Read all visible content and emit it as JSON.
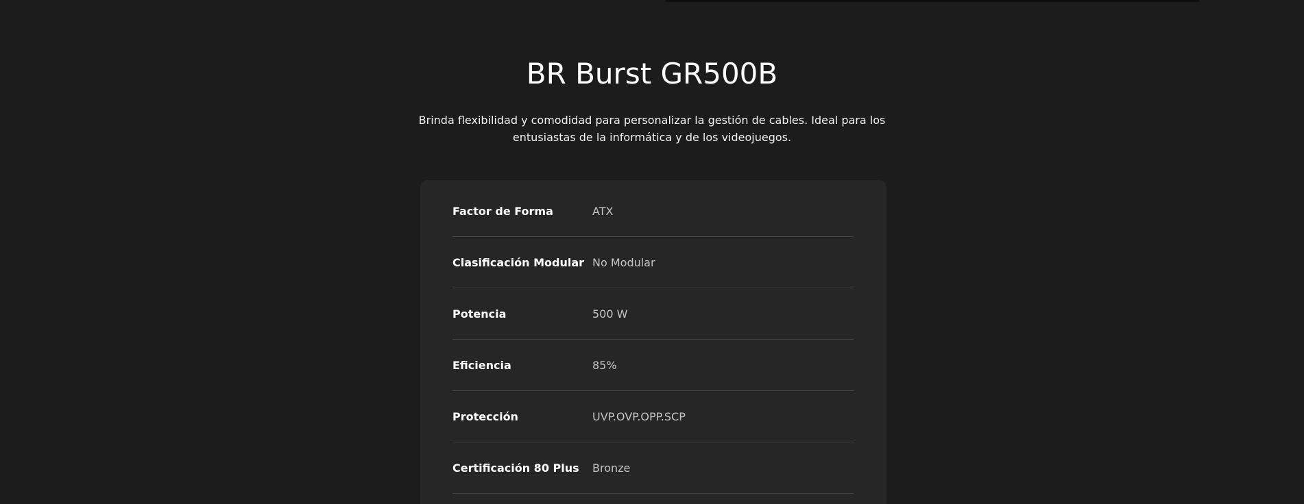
{
  "product": {
    "title": "BR Burst GR500B",
    "description": "Brinda flexibilidad y comodidad para personalizar la gestión de cables. Ideal para los entusiastas de la informática y de los videojuegos."
  },
  "specs": [
    {
      "label": "Factor de Forma",
      "value": "ATX"
    },
    {
      "label": "Clasificación Modular",
      "value": "No Modular"
    },
    {
      "label": "Potencia",
      "value": "500 W"
    },
    {
      "label": "Eficiencia",
      "value": "85%"
    },
    {
      "label": "Protección",
      "value": "UVP.OVP.OPP.SCP"
    },
    {
      "label": "Certificación 80 Plus",
      "value": "Bronze"
    }
  ],
  "colors": {
    "background": "#1c1c1c",
    "card": "#262626",
    "divider": "#424242",
    "text_primary": "#ffffff",
    "text_secondary": "#c4c4c4"
  }
}
